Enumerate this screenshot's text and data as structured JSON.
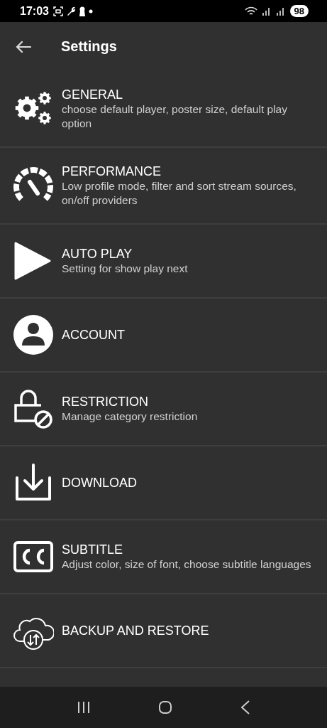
{
  "status_bar": {
    "time": "17:03",
    "battery": "98"
  },
  "app_bar": {
    "title": "Settings"
  },
  "items": [
    {
      "kind": "gears",
      "title": "GENERAL",
      "description": "choose default player, poster size, default play option"
    },
    {
      "kind": "gauge",
      "title": "PERFORMANCE",
      "description": "Low profile mode, filter and sort stream sources, on/off providers"
    },
    {
      "kind": "play",
      "title": "AUTO PLAY",
      "description": "Setting for show play next"
    },
    {
      "kind": "person",
      "title": "ACCOUNT"
    },
    {
      "kind": "lock",
      "title": "RESTRICTION",
      "description": "Manage category restriction"
    },
    {
      "kind": "download",
      "title": "DOWNLOAD"
    },
    {
      "kind": "cc",
      "title": "SUBTITLE",
      "description": "Adjust color, size of font, choose subtitle languages"
    },
    {
      "kind": "cloud",
      "title": "BACKUP AND RESTORE"
    }
  ]
}
